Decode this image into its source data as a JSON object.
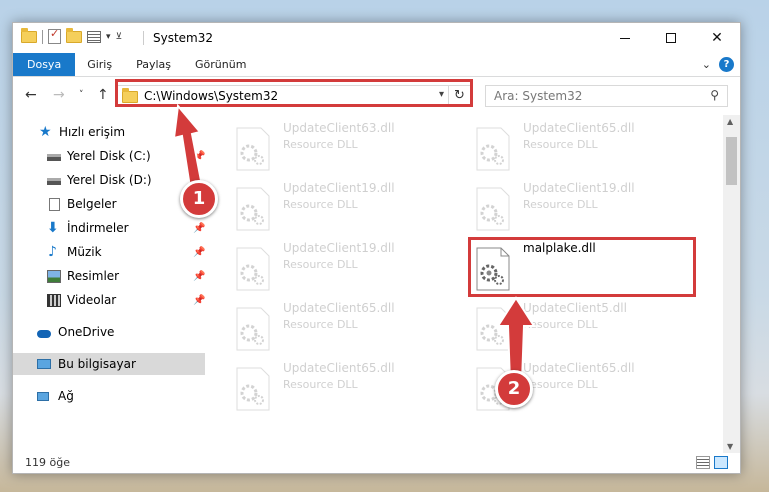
{
  "window": {
    "title": "System32",
    "controls": {
      "minimize": "minimize",
      "maximize": "maximize",
      "close": "✕"
    }
  },
  "ribbon": {
    "tabs": [
      "Dosya",
      "Giriş",
      "Paylaş",
      "Görünüm"
    ]
  },
  "address": {
    "path": "C:\\Windows\\System32"
  },
  "search": {
    "placeholder": "Ara: System32"
  },
  "sidebar": {
    "items": [
      {
        "label": "Hızlı erişim",
        "icon": "star-icon"
      },
      {
        "label": "Yerel Disk (C:)",
        "icon": "drive-icon"
      },
      {
        "label": "Yerel Disk (D:)",
        "icon": "drive-icon"
      },
      {
        "label": "Belgeler",
        "icon": "documents-icon"
      },
      {
        "label": "İndirmeler",
        "icon": "download-icon"
      },
      {
        "label": "Müzik",
        "icon": "music-icon"
      },
      {
        "label": "Resimler",
        "icon": "pictures-icon"
      },
      {
        "label": "Videolar",
        "icon": "videos-icon"
      },
      {
        "label": "OneDrive",
        "icon": "cloud-icon"
      },
      {
        "label": "Bu bilgisayar",
        "icon": "computer-icon"
      },
      {
        "label": "Ağ",
        "icon": "network-icon"
      }
    ]
  },
  "files": [
    {
      "name": "UpdateClient63.dll",
      "type": "Resource DLL"
    },
    {
      "name": "UpdateClient65.dll",
      "type": "Resource DLL"
    },
    {
      "name": "UpdateClient19.dll",
      "type": "Resource DLL"
    },
    {
      "name": "UpdateClient19.dll",
      "type": "Resource DLL"
    },
    {
      "name": "UpdateClient19.dll",
      "type": "Resource DLL"
    },
    {
      "name": "malplake.dll",
      "type": ""
    },
    {
      "name": "UpdateClient65.dll",
      "type": "Resource DLL"
    },
    {
      "name": "UpdateClient5.dll",
      "type": "Resource DLL"
    },
    {
      "name": "UpdateClient65.dll",
      "type": "Resource DLL"
    },
    {
      "name": "UpdateClient65.dll",
      "type": "Resource DLL"
    }
  ],
  "status": {
    "count": "119 öğe"
  },
  "annotations": {
    "step1": "1",
    "step2": "2",
    "color": "#d33b3b"
  }
}
